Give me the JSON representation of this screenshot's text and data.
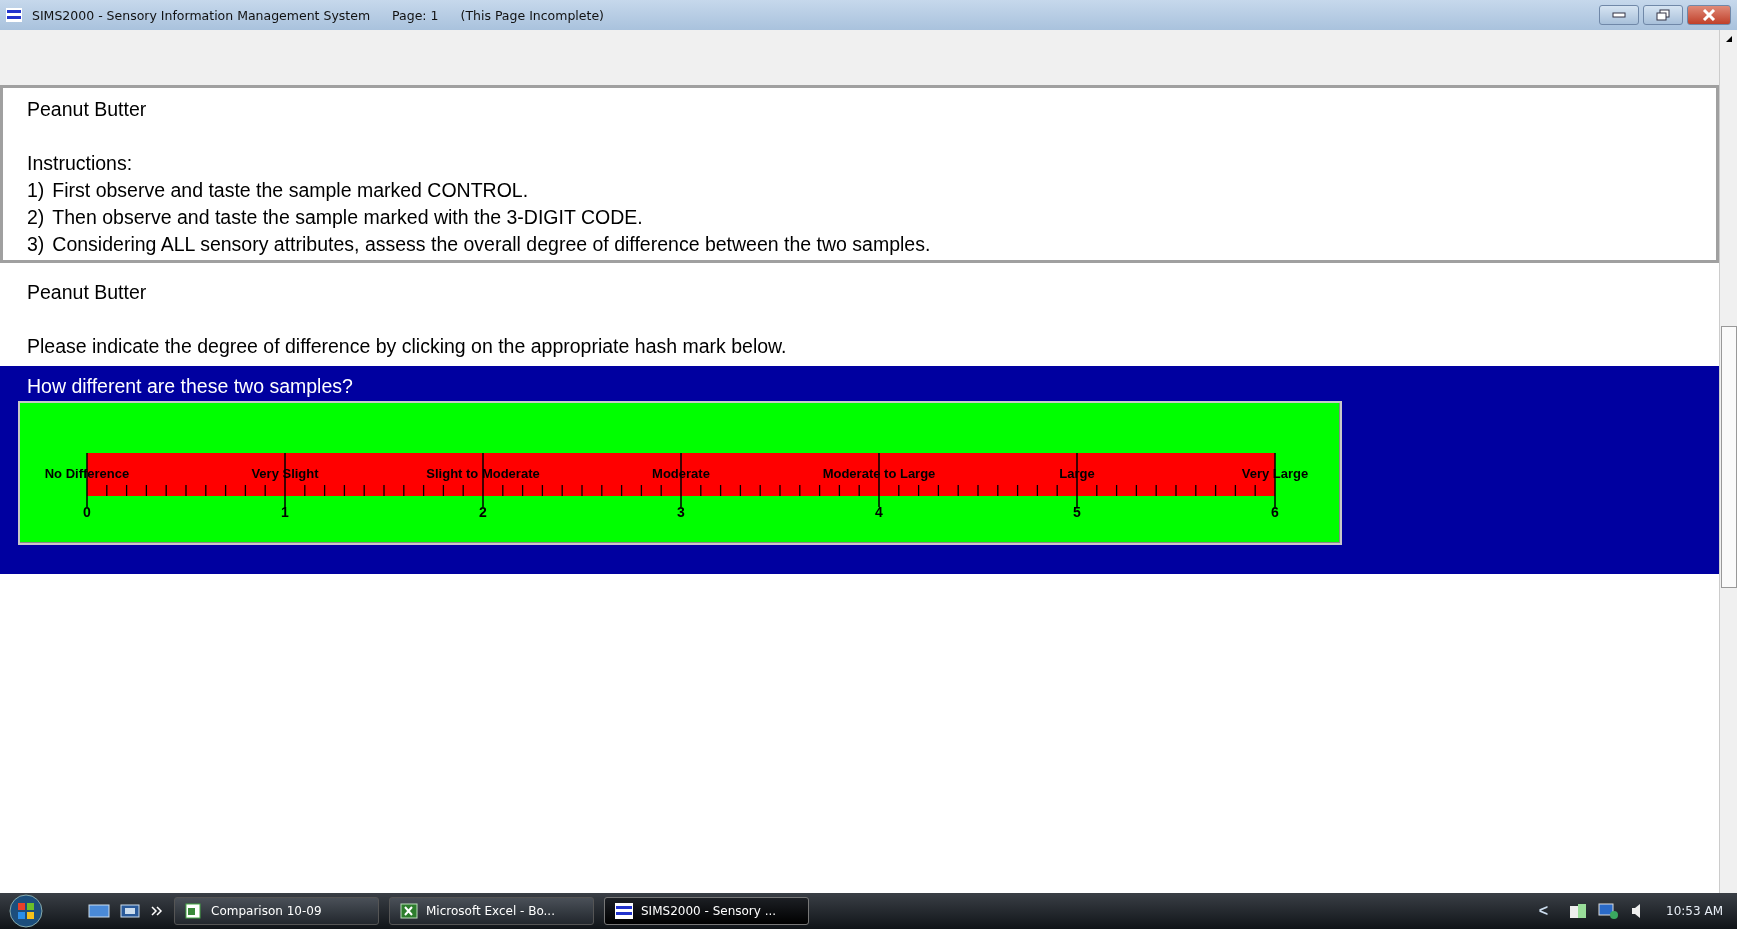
{
  "window": {
    "title": "SIMS2000 - Sensory Information Management System",
    "page": "Page: 1",
    "status": "(This Page Incomplete)"
  },
  "instructions_panel": {
    "heading": "Peanut Butter",
    "label": "Instructions:",
    "steps": [
      {
        "number": "1)",
        "text": "First observe and taste the sample marked CONTROL."
      },
      {
        "number": "2)",
        "text": "Then observe and taste the sample marked with the 3-DIGIT CODE."
      },
      {
        "number": "3)",
        "text": "Considering ALL sensory attributes, assess the overall degree of difference between the two samples."
      }
    ]
  },
  "question_panel": {
    "heading": "Peanut Butter",
    "prompt": "Please indicate the degree of difference by clicking on the appropriate hash mark below."
  },
  "scale": {
    "question": "How different are these two samples?",
    "anchors": [
      {
        "label": "No Difference",
        "number": "0"
      },
      {
        "label": "Very Slight",
        "number": "1"
      },
      {
        "label": "Slight to Moderate",
        "number": "2"
      },
      {
        "label": "Moderate",
        "number": "3"
      },
      {
        "label": "Moderate to Large",
        "number": "4"
      },
      {
        "label": "Large",
        "number": "5"
      },
      {
        "label": "Very Large",
        "number": "6"
      }
    ]
  },
  "taskbar": {
    "tasks": [
      {
        "label": "Comparison 10-09",
        "kind": "doc",
        "selected": false
      },
      {
        "label": "Microsoft Excel - Bo...",
        "kind": "excel",
        "selected": false
      },
      {
        "label": "SIMS2000 - Sensory ...",
        "kind": "sims",
        "selected": true
      }
    ],
    "tray_toggle": "<",
    "clock": "10:53 AM"
  }
}
